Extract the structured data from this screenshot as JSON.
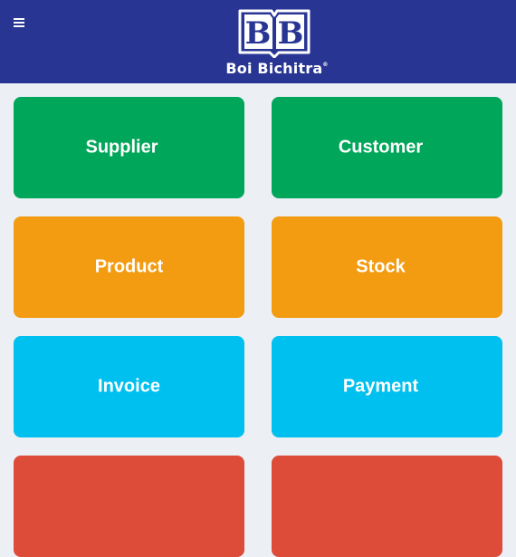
{
  "header": {
    "brand": "Boi Bichitra",
    "registered": "®",
    "logo_letters": "BB",
    "colors": {
      "background": "#283593",
      "foreground": "#ffffff"
    },
    "menu_icon": "hamburger-menu-icon"
  },
  "tiles": [
    {
      "label": "Supplier",
      "color": "#00a65a"
    },
    {
      "label": "Customer",
      "color": "#00a65a"
    },
    {
      "label": "Product",
      "color": "#f39c12"
    },
    {
      "label": "Stock",
      "color": "#f39c12"
    },
    {
      "label": "Invoice",
      "color": "#00c0ef"
    },
    {
      "label": "Payment",
      "color": "#00c0ef"
    },
    {
      "label": "",
      "color": "#dd4b39"
    },
    {
      "label": "",
      "color": "#dd4b39"
    }
  ]
}
